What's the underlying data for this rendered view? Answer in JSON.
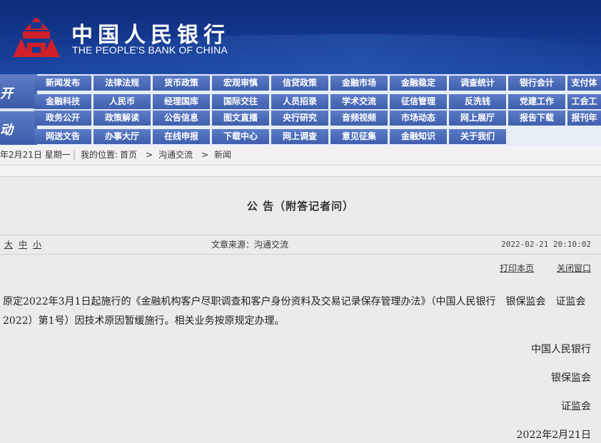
{
  "header": {
    "bank_name_cn": "中国人民银行",
    "bank_name_en": "THE PEOPLE'S BANK OF CHINA",
    "logo_icon": "pboc-emblem-icon",
    "colors": {
      "banner": "#14398f",
      "nav": "#4a6bb8",
      "emblem": "#d0202a"
    }
  },
  "nav": {
    "section1_label": "开",
    "section2_label": "动",
    "row1": [
      "新闻发布",
      "法律法规",
      "货币政策",
      "宏观审慎",
      "信贷政策",
      "金融市场",
      "金融稳定",
      "调查统计",
      "银行会计",
      "支付体"
    ],
    "row2": [
      "金融科技",
      "人民币",
      "经理国库",
      "国际交往",
      "人员招录",
      "学术交流",
      "征信管理",
      "反洗钱",
      "党建工作",
      "工会工"
    ],
    "row3": [
      "政务公开",
      "政策解读",
      "公告信息",
      "图文直播",
      "央行研究",
      "音频视频",
      "市场动态",
      "网上展厅",
      "报告下载",
      "报刊年"
    ],
    "row4": [
      "网送文告",
      "办事大厅",
      "在线申报",
      "下载中心",
      "网上调查",
      "意见征集",
      "金融知识",
      "关于我们"
    ]
  },
  "breadcrumb": {
    "date": "年2月21日 星期一",
    "location_label": "我的位置:",
    "home": "首页",
    "level1": "沟通交流",
    "level2": "新闻",
    "sep": ">"
  },
  "article": {
    "title": "公 告（附答记者问）",
    "size_large": "大",
    "size_medium": "中",
    "size_small": "小",
    "source": "文章来源：沟通交流",
    "datetime": "2022-02-21  20:10:02",
    "print": "打印本页",
    "close": "关闭窗口",
    "para_line1": "原定2022年3月1日起施行的《金融机构客户尽职调查和客户身份资料及交易记录保存管理办法》（中国人民银行　银保监会　证监会",
    "para_line2": "2022）第1号）因技术原因暂缓施行。相关业务按原规定办理。",
    "sign1": "中国人民银行",
    "sign2": "银保监会",
    "sign3": "证监会",
    "sign_date": "2022年2月21日"
  }
}
